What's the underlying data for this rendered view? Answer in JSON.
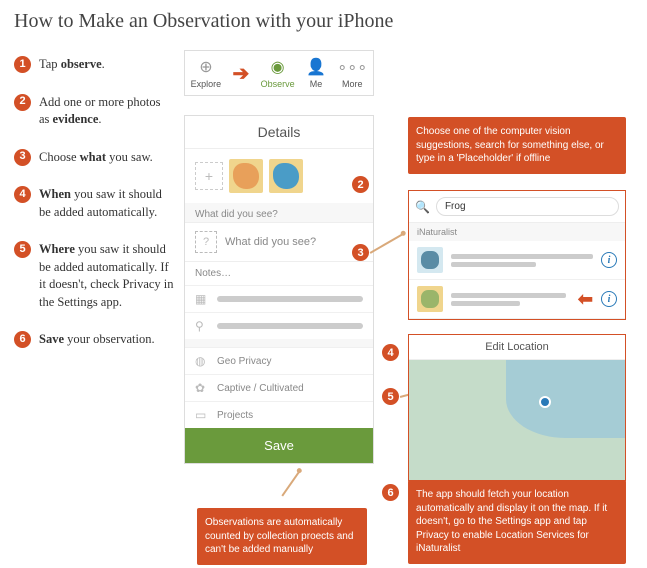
{
  "title": "How to Make an Observation with your iPhone",
  "steps": [
    {
      "num": "1",
      "html": "Tap <b>observe</b>."
    },
    {
      "num": "2",
      "html": "Add one or more photos as <b>evidence</b>."
    },
    {
      "num": "3",
      "html": "Choose <b>what</b> you saw."
    },
    {
      "num": "4",
      "html": "<b>When</b> you saw it should be added automatically."
    },
    {
      "num": "5",
      "html": "<b>Where</b> you saw it should be added automatically. If it doesn't, check Privacy in the Settings app."
    },
    {
      "num": "6",
      "html": "<b>Save</b> your observation."
    }
  ],
  "tabs": {
    "explore": "Explore",
    "observe": "Observe",
    "me": "Me",
    "more": "More"
  },
  "details": {
    "header": "Details",
    "what_label": "What did you see?",
    "what_placeholder": "What did you see?",
    "notes": "Notes…",
    "geo": "Geo Privacy",
    "captive": "Captive / Cultivated",
    "projects": "Projects",
    "save": "Save"
  },
  "tip_cv": "Choose one of the computer vision suggestions, search for something else, or type in a 'Placeholder' if offline",
  "search": {
    "query": "Frog",
    "header": "iNaturalist"
  },
  "map": {
    "header": "Edit Location"
  },
  "tip_map": "The app should fetch your location automatically and display it on the map. If it doesn't, go to the Settings app and tap Privacy to enable Location Services for iNaturalist",
  "tip_projects": "Observations are automatically counted by collection proects and can't be added manually"
}
